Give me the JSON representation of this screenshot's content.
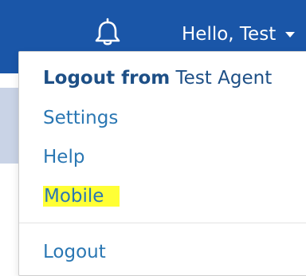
{
  "header": {
    "bell_icon": "bell-icon",
    "greeting": "Hello, Test",
    "caret_icon": "caret-down-icon",
    "background_color": "#1a56a8"
  },
  "menu": {
    "header_bold": "Logout from",
    "header_name": "Test Agent",
    "items": [
      {
        "label": "Settings"
      },
      {
        "label": "Help"
      },
      {
        "label": "Mobile",
        "highlight_color": "#ffff35"
      }
    ],
    "logout_label": "Logout",
    "link_color": "#2a77b3"
  }
}
